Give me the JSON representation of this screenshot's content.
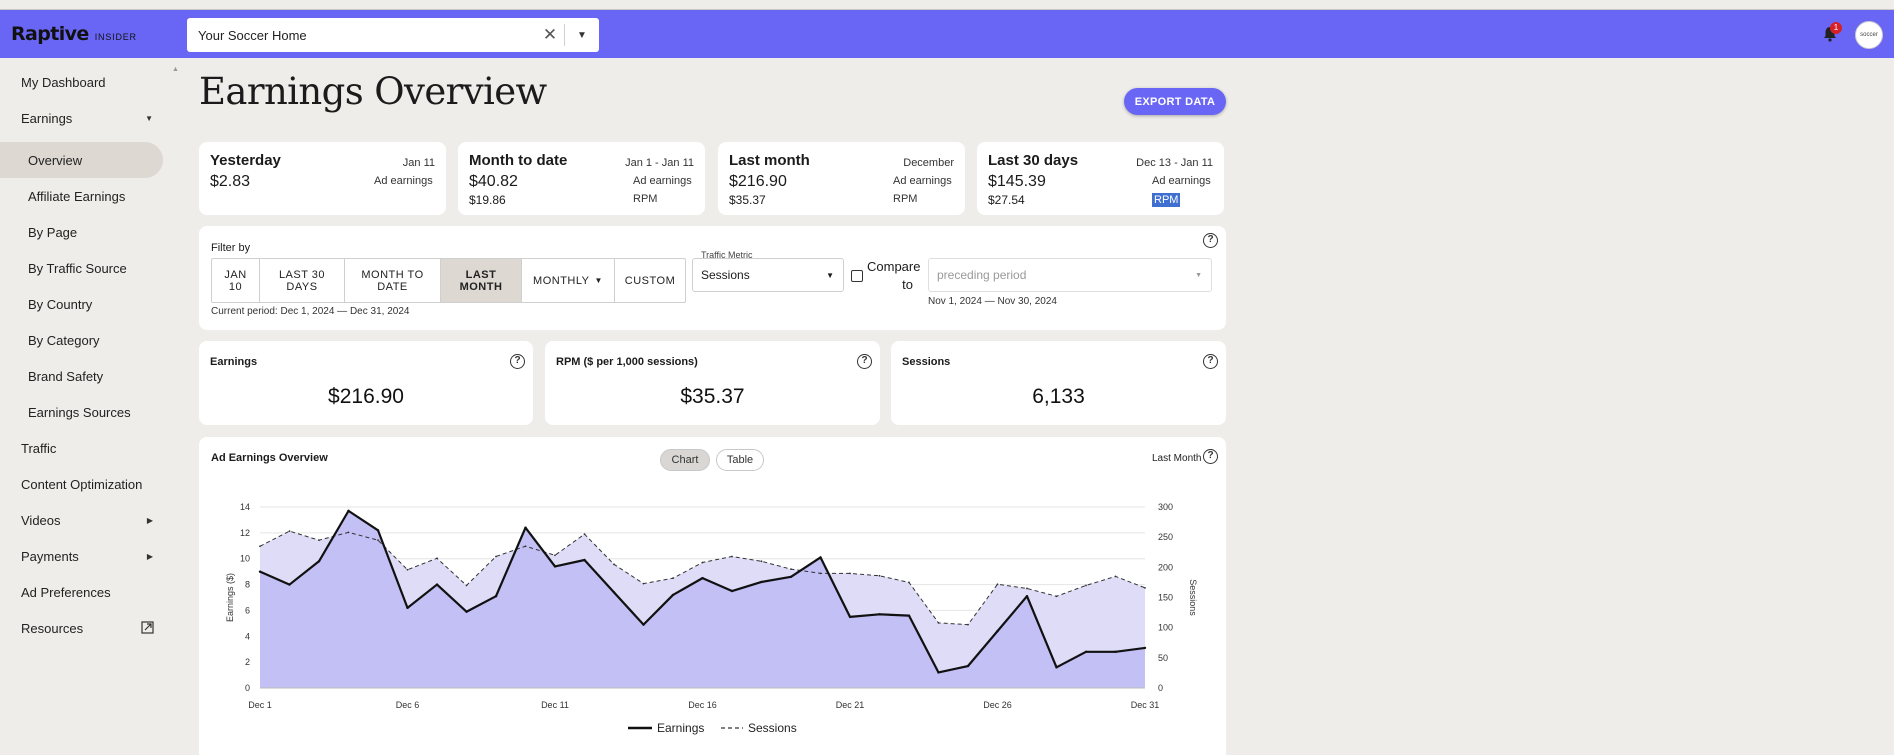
{
  "header": {
    "logo_main": "Raptive",
    "logo_sub": "INSIDER",
    "site_selector": "Your Soccer Home",
    "notification_count": "1",
    "avatar_text": "soccer"
  },
  "sidebar": {
    "items": [
      {
        "label": "My Dashboard"
      },
      {
        "label": "Earnings"
      },
      {
        "label": "Overview"
      },
      {
        "label": "Affiliate Earnings"
      },
      {
        "label": "By Page"
      },
      {
        "label": "By Traffic Source"
      },
      {
        "label": "By Country"
      },
      {
        "label": "By Category"
      },
      {
        "label": "Brand Safety"
      },
      {
        "label": "Earnings Sources"
      },
      {
        "label": "Traffic"
      },
      {
        "label": "Content Optimization"
      },
      {
        "label": "Videos"
      },
      {
        "label": "Payments"
      },
      {
        "label": "Ad Preferences"
      },
      {
        "label": "Resources"
      }
    ]
  },
  "page": {
    "title": "Earnings Overview",
    "export_label": "EXPORT DATA"
  },
  "summary": [
    {
      "title": "Yesterday",
      "date": "Jan 11",
      "amount": "$2.83",
      "l1": "Ad earnings",
      "rpm": "",
      "l2": ""
    },
    {
      "title": "Month to date",
      "date": "Jan 1 - Jan 11",
      "amount": "$40.82",
      "l1": "Ad earnings",
      "rpm": "$19.86",
      "l2": "RPM"
    },
    {
      "title": "Last month",
      "date": "December",
      "amount": "$216.90",
      "l1": "Ad earnings",
      "rpm": "$35.37",
      "l2": "RPM"
    },
    {
      "title": "Last 30 days",
      "date": "Dec 13 - Jan 11",
      "amount": "$145.39",
      "l1": "Ad earnings",
      "rpm": "$27.54",
      "l2": "RPM"
    }
  ],
  "filter": {
    "label": "Filter by",
    "buttons": [
      "JAN 10",
      "LAST 30 DAYS",
      "MONTH TO DATE",
      "LAST MONTH",
      "MONTHLY",
      "CUSTOM"
    ],
    "active": "LAST MONTH",
    "current_period": "Current period: Dec 1, 2024 — Dec 31, 2024",
    "metric_label": "Traffic Metric",
    "metric_value": "Sessions",
    "compare_label": "Compare to",
    "compare_placeholder": "preceding period",
    "compare_range": "Nov 1, 2024 — Nov 30, 2024"
  },
  "metrics": [
    {
      "title": "Earnings",
      "value": "$216.90"
    },
    {
      "title": "RPM ($ per 1,000 sessions)",
      "value": "$35.37"
    },
    {
      "title": "Sessions",
      "value": "6,133"
    }
  ],
  "chart": {
    "title": "Ad Earnings Overview",
    "toggle_chart": "Chart",
    "toggle_table": "Table",
    "period_label": "Last Month"
  },
  "colors": {
    "accent": "#6a66f5",
    "earnings_fill": "#c3c0f5",
    "sessions_fill": "#dedcf7",
    "highlight": "#3f6fd1"
  },
  "chart_data": {
    "type": "area",
    "x": [
      "Dec 1",
      "Dec 2",
      "Dec 3",
      "Dec 4",
      "Dec 5",
      "Dec 6",
      "Dec 7",
      "Dec 8",
      "Dec 9",
      "Dec 10",
      "Dec 11",
      "Dec 12",
      "Dec 13",
      "Dec 14",
      "Dec 15",
      "Dec 16",
      "Dec 17",
      "Dec 18",
      "Dec 19",
      "Dec 20",
      "Dec 21",
      "Dec 22",
      "Dec 23",
      "Dec 24",
      "Dec 25",
      "Dec 26",
      "Dec 27",
      "Dec 28",
      "Dec 29",
      "Dec 30",
      "Dec 31"
    ],
    "x_ticks": [
      "Dec 1",
      "Dec 6",
      "Dec 11",
      "Dec 16",
      "Dec 21",
      "Dec 26",
      "Dec 31"
    ],
    "ylabel": "Earnings ($)",
    "ylabel_right": "Sessions",
    "ylim": [
      0,
      14
    ],
    "ylim_right": [
      0,
      300
    ],
    "yticks_left": [
      0,
      2,
      4,
      6,
      8,
      10,
      12,
      14
    ],
    "yticks_right": [
      0,
      50,
      100,
      150,
      200,
      250,
      300
    ],
    "series": [
      {
        "name": "Earnings",
        "axis": "left",
        "style": "solid",
        "values": [
          9.0,
          8.0,
          9.8,
          13.7,
          12.2,
          6.2,
          8.0,
          5.9,
          7.1,
          12.4,
          9.4,
          9.9,
          7.4,
          4.9,
          7.2,
          8.5,
          7.5,
          8.2,
          8.6,
          10.1,
          5.5,
          5.7,
          5.6,
          1.2,
          1.7,
          4.4,
          7.1,
          1.6,
          2.8,
          2.8,
          3.1
        ]
      },
      {
        "name": "Sessions",
        "axis": "right",
        "style": "dashed",
        "values": [
          235,
          260,
          245,
          258,
          245,
          196,
          215,
          170,
          218,
          235,
          220,
          255,
          205,
          173,
          182,
          208,
          218,
          210,
          197,
          190,
          190,
          186,
          175,
          108,
          105,
          172,
          165,
          152,
          170,
          185,
          166
        ]
      }
    ],
    "legend": "bottom",
    "grid": true
  }
}
